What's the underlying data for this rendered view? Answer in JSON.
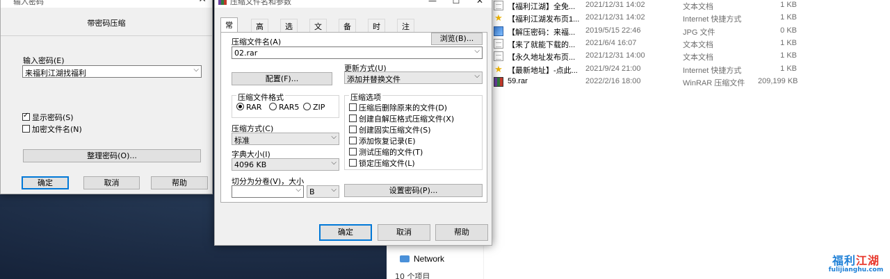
{
  "explorer": {
    "files": [
      {
        "icon": "text-file-icon",
        "name": "【福利江湖】全免...",
        "date": "2021/12/31 14:02",
        "type": "文本文档",
        "size": "1 KB"
      },
      {
        "icon": "internet-shortcut-icon",
        "name": "【福利江湖发布页1...",
        "date": "2021/12/31 14:02",
        "type": "Internet 快捷方式",
        "size": "1 KB"
      },
      {
        "icon": "jpg-file-icon",
        "name": "【解压密码：来福...",
        "date": "2019/5/15 22:46",
        "type": "JPG 文件",
        "size": "0 KB"
      },
      {
        "icon": "text-file-icon",
        "name": "【来了就能下载的...",
        "date": "2021/6/4 16:07",
        "type": "文本文档",
        "size": "1 KB"
      },
      {
        "icon": "text-file-icon",
        "name": "【永久地址发布页...",
        "date": "2021/12/31 14:00",
        "type": "文本文档",
        "size": "1 KB"
      },
      {
        "icon": "internet-shortcut-icon",
        "name": "【最新地址】-点此...",
        "date": "2021/9/24 21:00",
        "type": "Internet 快捷方式",
        "size": "1 KB"
      },
      {
        "icon": "rar-file-icon",
        "name": "59.rar",
        "date": "2022/2/16 18:00",
        "type": "WinRAR 压缩文件",
        "size": "209,199 KB"
      }
    ],
    "network_label": "Network",
    "status_text": "10 个项目"
  },
  "watermark": {
    "cn_blue": "福利",
    "cn_red": "江湖",
    "en": "fulijianghu.com"
  },
  "password_dialog": {
    "title": "输入密码",
    "heading": "带密码压缩",
    "enter_label": "输入密码(E)",
    "password_value": "来福利江湖找福利",
    "show_password": {
      "label": "显示密码(S)",
      "checked": true
    },
    "encrypt_names": {
      "label": "加密文件名(N)",
      "checked": false
    },
    "organize_button": "整理密码(O)...",
    "ok": "确定",
    "cancel": "取消",
    "help": "帮助"
  },
  "archive_dialog": {
    "title": "压缩文件名和参数",
    "tabs": [
      "常规",
      "高级",
      "选项",
      "文件",
      "备份",
      "时间",
      "注释"
    ],
    "active_tab": "常规",
    "archive_name_label": "压缩文件名(A)",
    "browse_button": "浏览(B)...",
    "archive_name": "02.rar",
    "profiles_button": "配置(F)...",
    "update_mode_label": "更新方式(U)",
    "update_mode": "添加并替换文件",
    "format_label": "压缩文件格式",
    "formats": [
      {
        "label": "RAR",
        "selected": true
      },
      {
        "label": "RAR5",
        "selected": false
      },
      {
        "label": "ZIP",
        "selected": false
      }
    ],
    "method_label": "压缩方式(C)",
    "method": "标准",
    "dict_label": "字典大小(I)",
    "dict": "4096 KB",
    "split_label": "切分为分卷(V)，大小",
    "split_value": "",
    "split_unit": "B",
    "options_label": "压缩选项",
    "options": [
      {
        "label": "压缩后删除原来的文件(D)",
        "checked": false
      },
      {
        "label": "创建自解压格式压缩文件(X)",
        "checked": false
      },
      {
        "label": "创建固实压缩文件(S)",
        "checked": false
      },
      {
        "label": "添加恢复记录(E)",
        "checked": false
      },
      {
        "label": "测试压缩的文件(T)",
        "checked": false
      },
      {
        "label": "锁定压缩文件(L)",
        "checked": false
      }
    ],
    "set_password_button": "设置密码(P)...",
    "ok": "确定",
    "cancel": "取消",
    "help": "帮助"
  }
}
